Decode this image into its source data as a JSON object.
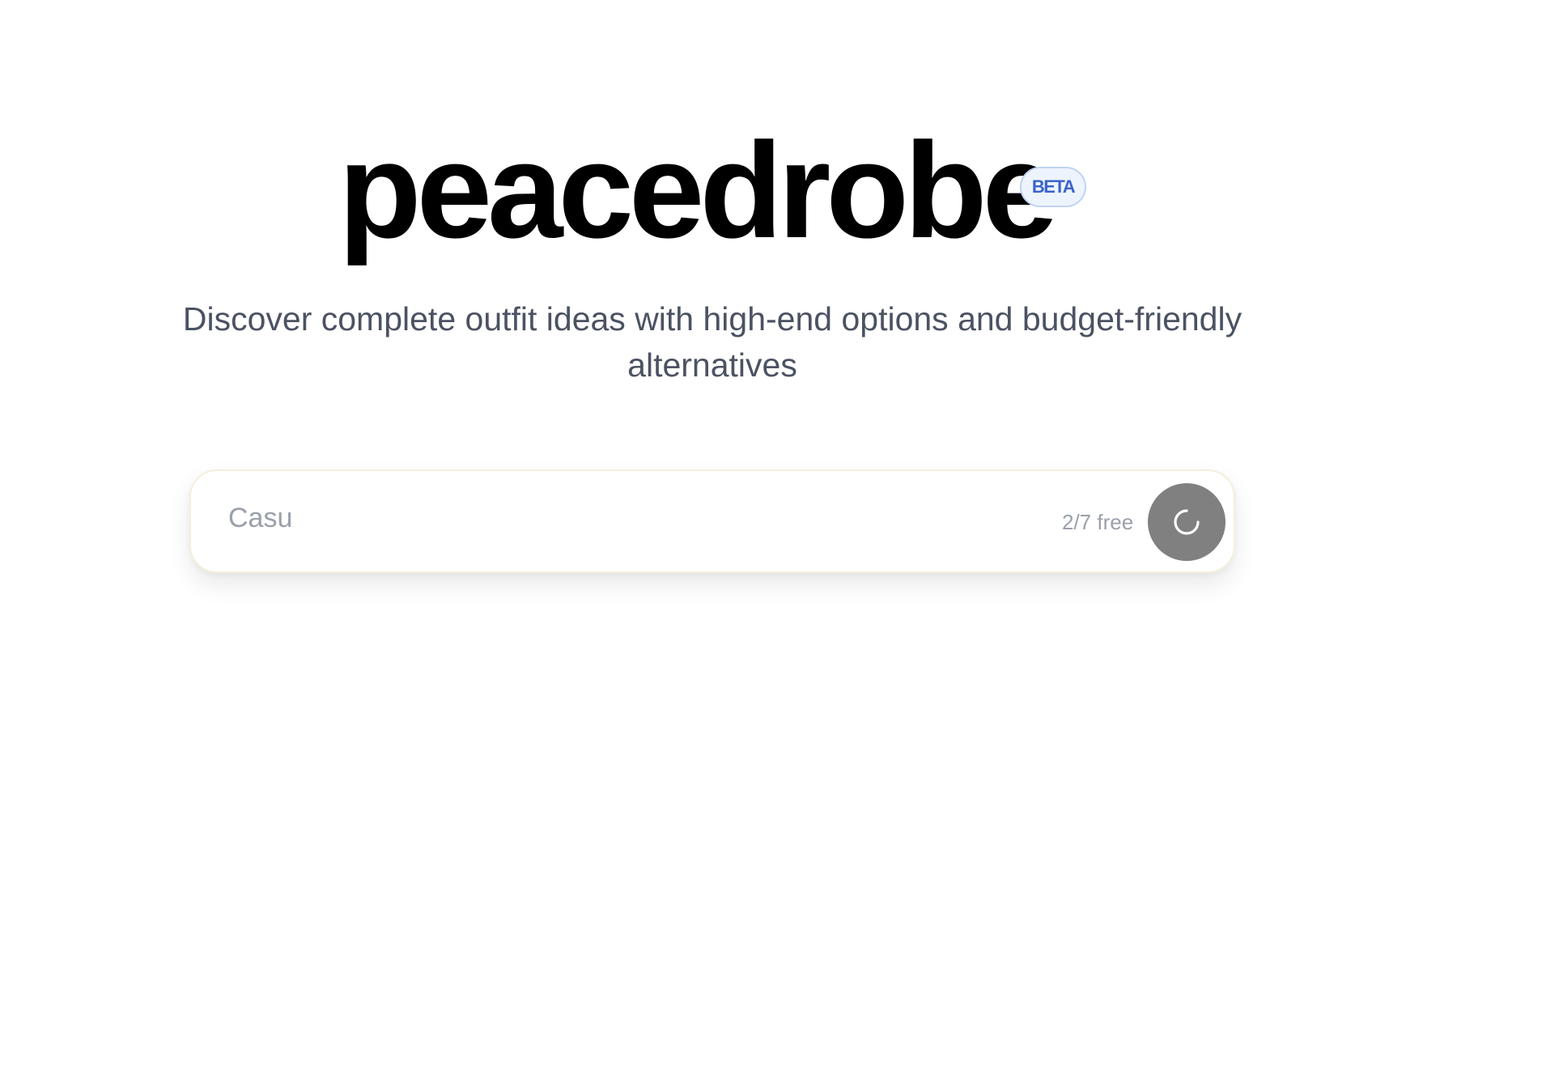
{
  "brand": {
    "name": "peacedrobe",
    "badge": "BETA"
  },
  "tagline": "Discover complete outfit ideas with high-end options and budget-friendly alternatives",
  "search": {
    "value": "Casu",
    "placeholder": "",
    "usage": "2/7 free",
    "submit_state": "loading",
    "submit_icon": "spinner-icon"
  },
  "colors": {
    "badge_background": "#eef4fd",
    "badge_border": "#bfd3f3",
    "badge_text": "#3b63c9",
    "tagline_text": "#4b5262",
    "submit_button": "#808080",
    "placeholder_text": "#9aa0aa"
  }
}
